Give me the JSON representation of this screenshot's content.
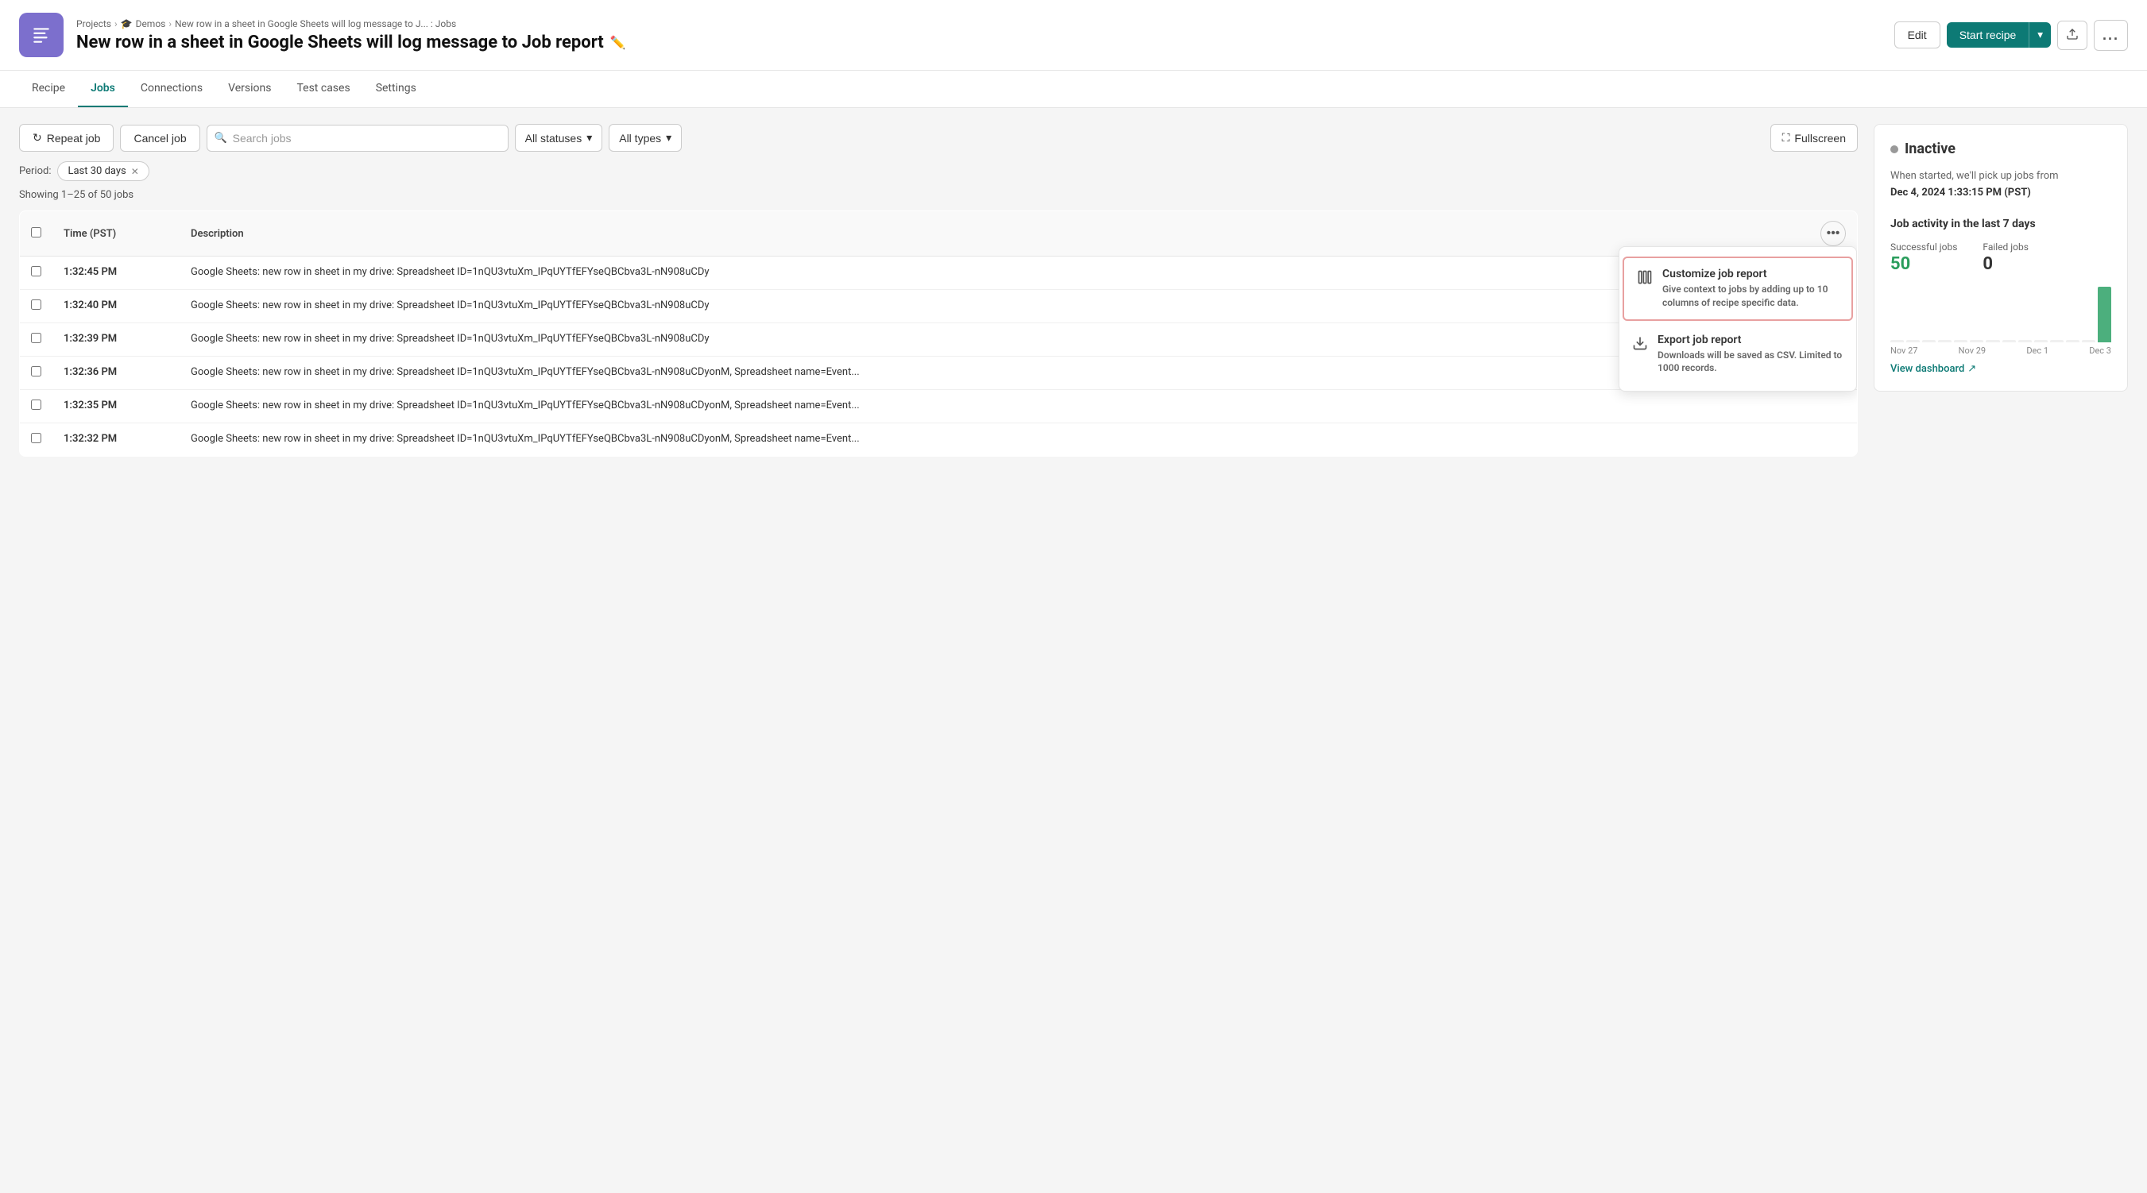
{
  "breadcrumb": {
    "projects": "Projects",
    "demos": "Demos",
    "current": "New row in a sheet in Google Sheets will log message to J... : Jobs"
  },
  "header": {
    "title": "New row in a sheet in Google Sheets will log message to Job report",
    "edit_icon": "✏️"
  },
  "actions": {
    "edit_label": "Edit",
    "start_recipe_label": "Start recipe",
    "more_label": "..."
  },
  "tabs": [
    {
      "id": "recipe",
      "label": "Recipe",
      "active": false
    },
    {
      "id": "jobs",
      "label": "Jobs",
      "active": true
    },
    {
      "id": "connections",
      "label": "Connections",
      "active": false
    },
    {
      "id": "versions",
      "label": "Versions",
      "active": false
    },
    {
      "id": "test_cases",
      "label": "Test cases",
      "active": false
    },
    {
      "id": "settings",
      "label": "Settings",
      "active": false
    }
  ],
  "toolbar": {
    "repeat_job": "Repeat job",
    "cancel_job": "Cancel job",
    "search_placeholder": "Search jobs",
    "all_statuses": "All statuses",
    "all_types": "All types",
    "fullscreen": "Fullscreen"
  },
  "period": {
    "label": "Period:",
    "value": "Last 30 days"
  },
  "showing": "Showing 1–25 of 50 jobs",
  "table": {
    "col_time": "Time (PST)",
    "col_description": "Description",
    "rows": [
      {
        "time": "1:32:45 PM",
        "description": "Google Sheets: new row in sheet in my drive: Spreadsheet ID=1nQU3vtuXm_IPqUYTfEFYseQBCbva3L-nN908uCDy"
      },
      {
        "time": "1:32:40 PM",
        "description": "Google Sheets: new row in sheet in my drive: Spreadsheet ID=1nQU3vtuXm_IPqUYTfEFYseQBCbva3L-nN908uCDy"
      },
      {
        "time": "1:32:39 PM",
        "description": "Google Sheets: new row in sheet in my drive: Spreadsheet ID=1nQU3vtuXm_IPqUYTfEFYseQBCbva3L-nN908uCDy"
      },
      {
        "time": "1:32:36 PM",
        "description": "Google Sheets: new row in sheet in my drive: Spreadsheet ID=1nQU3vtuXm_IPqUYTfEFYseQBCbva3L-nN908uCDyonM, Spreadsheet name=Event..."
      },
      {
        "time": "1:32:35 PM",
        "description": "Google Sheets: new row in sheet in my drive: Spreadsheet ID=1nQU3vtuXm_IPqUYTfEFYseQBCbva3L-nN908uCDyonM, Spreadsheet name=Event..."
      },
      {
        "time": "1:32:32 PM",
        "description": "Google Sheets: new row in sheet in my drive: Spreadsheet ID=1nQU3vtuXm_IPqUYTfEFYseQBCbva3L-nN908uCDyonM, Spreadsheet name=Event..."
      }
    ]
  },
  "popup": {
    "customize_title": "Customize job report",
    "customize_desc": "Give context to jobs by adding up to 10 columns of recipe specific data.",
    "export_title": "Export job report",
    "export_desc": "Downloads will be saved as CSV. Limited to 1000 records."
  },
  "sidebar": {
    "status_label": "Inactive",
    "status_desc": "When started, we'll pick up jobs from",
    "status_date": "Dec 4, 2024 1:33:15 PM (PST)",
    "activity_title": "Job activity in the last 7 days",
    "successful_label": "Successful jobs",
    "successful_value": "50",
    "failed_label": "Failed jobs",
    "failed_value": "0",
    "view_dashboard": "View dashboard",
    "chart": {
      "labels": [
        "Nov 27",
        "Nov 29",
        "Dec 1",
        "Dec 3"
      ],
      "bars": [
        0,
        0,
        0,
        0,
        0,
        0,
        0,
        0,
        0,
        0,
        0,
        0,
        0,
        100
      ]
    }
  }
}
